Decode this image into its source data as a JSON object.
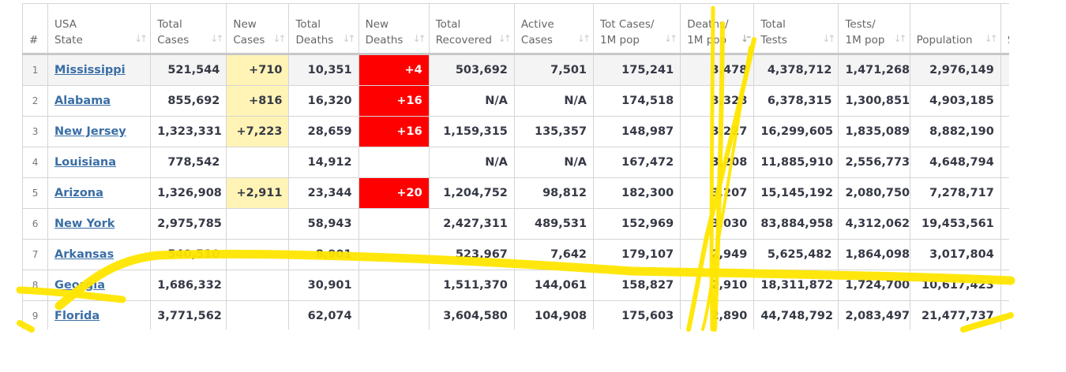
{
  "columns": [
    {
      "l1": "#",
      "l2": ""
    },
    {
      "l1": "USA",
      "l2": "State"
    },
    {
      "l1": "Total",
      "l2": "Cases"
    },
    {
      "l1": "New",
      "l2": "Cases"
    },
    {
      "l1": "Total",
      "l2": "Deaths"
    },
    {
      "l1": "New",
      "l2": "Deaths"
    },
    {
      "l1": "Total",
      "l2": "Recovered"
    },
    {
      "l1": "Active",
      "l2": "Cases"
    },
    {
      "l1": "Tot Cases/",
      "l2": "1M pop"
    },
    {
      "l1": "Deaths/",
      "l2": "1M pop"
    },
    {
      "l1": "Total",
      "l2": "Tests"
    },
    {
      "l1": "Tests/",
      "l2": "1M pop"
    },
    {
      "l1": "",
      "l2": "Population"
    },
    {
      "l1": "",
      "l2": "S"
    }
  ],
  "sorted_column": "Deaths/ 1M pop",
  "rows": [
    [
      "1",
      "Mississippi",
      "521,544",
      "+710",
      "10,351",
      "+4",
      "503,692",
      "7,501",
      "175,241",
      "3,478",
      "4,378,712",
      "1,471,268",
      "2,976,149"
    ],
    [
      "2",
      "Alabama",
      "855,692",
      "+816",
      "16,320",
      "+16",
      "N/A",
      "N/A",
      "174,518",
      "3,328",
      "6,378,315",
      "1,300,851",
      "4,903,185"
    ],
    [
      "3",
      "New Jersey",
      "1,323,331",
      "+7,223",
      "28,659",
      "+16",
      "1,159,315",
      "135,357",
      "148,987",
      "3,227",
      "16,299,605",
      "1,835,089",
      "8,882,190"
    ],
    [
      "4",
      "Louisiana",
      "778,542",
      "",
      "14,912",
      "",
      "N/A",
      "N/A",
      "167,472",
      "3,208",
      "11,885,910",
      "2,556,773",
      "4,648,794"
    ],
    [
      "5",
      "Arizona",
      "1,326,908",
      "+2,911",
      "23,344",
      "+20",
      "1,204,752",
      "98,812",
      "182,300",
      "3,207",
      "15,145,192",
      "2,080,750",
      "7,278,717"
    ],
    [
      "6",
      "New York",
      "2,975,785",
      "",
      "58,943",
      "",
      "2,427,311",
      "489,531",
      "152,969",
      "3,030",
      "83,884,958",
      "4,312,062",
      "19,453,561"
    ],
    [
      "7",
      "Arkansas",
      "540,510",
      "",
      "8,901",
      "",
      "523,967",
      "7,642",
      "179,107",
      "2,949",
      "5,625,482",
      "1,864,098",
      "3,017,804"
    ],
    [
      "8",
      "Georgia",
      "1,686,332",
      "",
      "30,901",
      "",
      "1,511,370",
      "144,061",
      "158,827",
      "2,910",
      "18,311,872",
      "1,724,700",
      "10,617,423"
    ],
    [
      "9",
      "Florida",
      "3,771,562",
      "",
      "62,074",
      "",
      "3,604,580",
      "104,908",
      "175,603",
      "2,890",
      "44,748,792",
      "2,083,497",
      "21,477,737"
    ]
  ],
  "colors": {
    "new_cases_bg": "#fff3b5",
    "new_deaths_bg": "#ff0000",
    "link": "#3a6ea5",
    "highlighter": "#ffe600"
  }
}
